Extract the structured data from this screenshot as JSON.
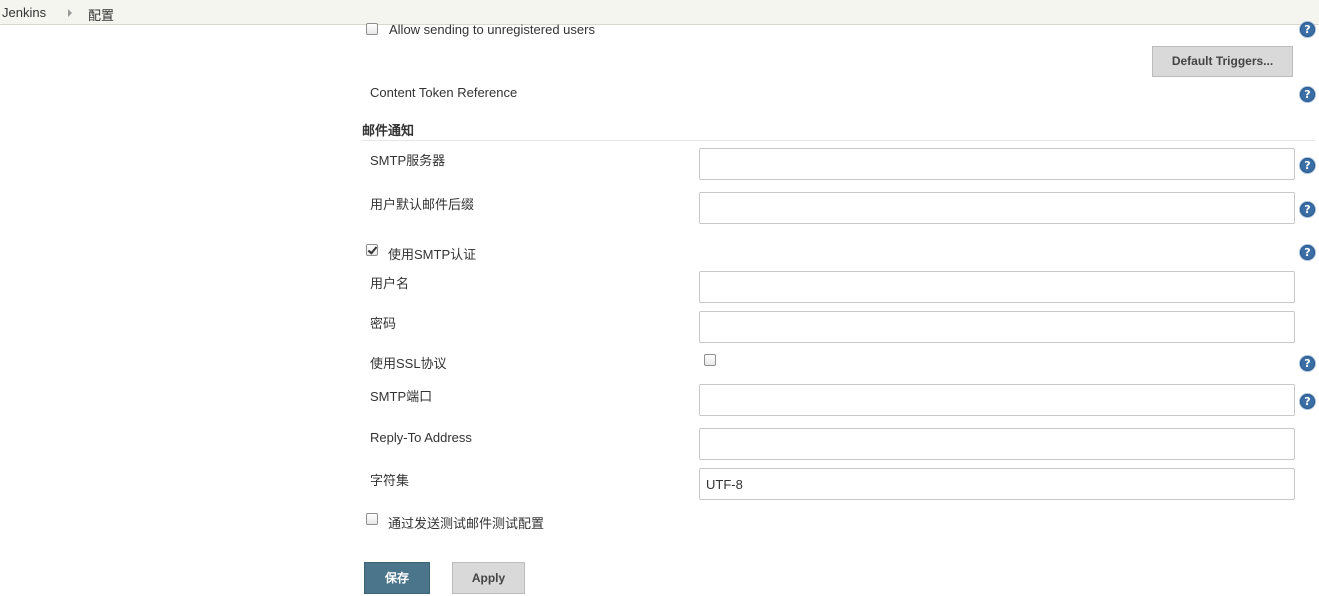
{
  "breadcrumb": {
    "root": "Jenkins",
    "current": "配置"
  },
  "top": {
    "allow_unregistered_label": "Allow sending to unregistered users",
    "default_triggers_label": "Default Triggers...",
    "content_token_label": "Content Token Reference"
  },
  "mail": {
    "section_title": "邮件通知",
    "smtp_server_label": "SMTP服务器",
    "smtp_server_value": "",
    "default_suffix_label": "用户默认邮件后缀",
    "default_suffix_value": "",
    "use_smtp_auth_label": "使用SMTP认证",
    "use_smtp_auth_checked": true,
    "username_label": "用户名",
    "username_value": "",
    "password_label": "密码",
    "password_value": "",
    "use_ssl_label": "使用SSL协议",
    "use_ssl_checked": false,
    "smtp_port_label": "SMTP端口",
    "smtp_port_value": "",
    "reply_to_label": "Reply-To Address",
    "reply_to_value": "",
    "charset_label": "字符集",
    "charset_value": "UTF-8",
    "test_config_label": "通过发送测试邮件测试配置",
    "test_config_checked": false
  },
  "actions": {
    "save_label": "保存",
    "apply_label": "Apply"
  },
  "icons": {
    "help": "help-icon",
    "breadcrumb_separator": "chevron-right-icon"
  },
  "colors": {
    "primary_button": "#4b758b",
    "help_icon": "#3a6ea5",
    "breadcrumb_bg": "#f5f5ef"
  }
}
